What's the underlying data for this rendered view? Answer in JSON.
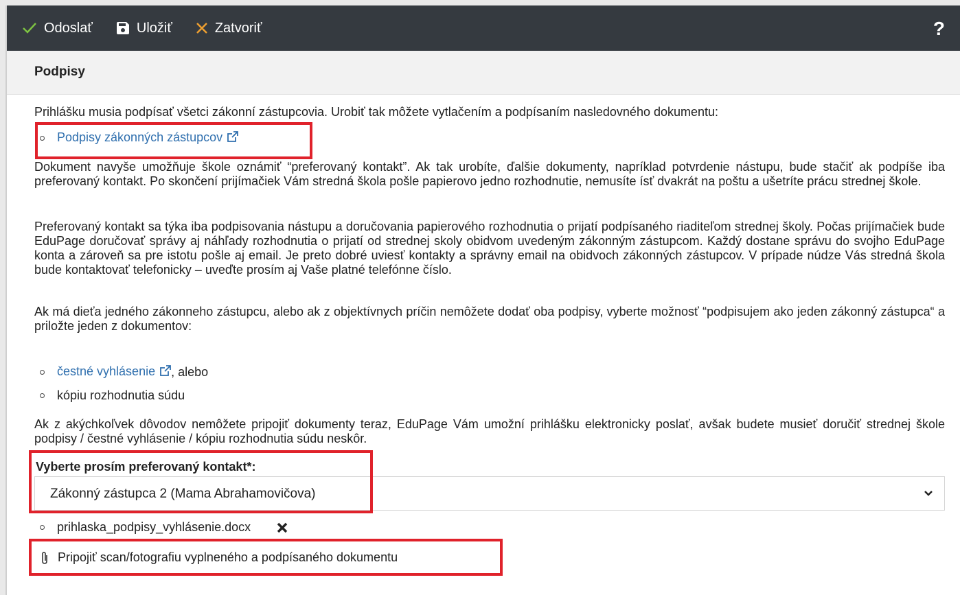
{
  "toolbar": {
    "send_label": "Odoslať",
    "save_label": "Uložiť",
    "close_label": "Zatvoriť",
    "help_label": "?"
  },
  "section": {
    "title": "Podpisy"
  },
  "content": {
    "intro": "Prihlášku musia podpísať všetci zákonní zástupcovia. Urobiť tak môžete vytlačením a podpísaním nasledovného dokumentu:",
    "signatures_link": "Podpisy zákonných zástupcov",
    "para_preferred": "Dokument navyše umožňuje škole oznámiť “preferovaný kontakt”. Ak tak urobíte, ďalšie dokumenty, napríklad potvrdenie nástupu, bude stačiť ak podpíše iba preferovaný kontakt. Po skončení prijímačiek Vám stredná škola pošle papierovo jedno rozhodnutie, nemusíte ísť dvakrát na poštu a ušetríte prácu strednej škole.",
    "para_contact": "Preferovaný kontakt sa týka iba podpisovania nástupu a doručovania papierového rozhodnutia o prijatí podpísaného riaditeľom strednej školy. Počas prijímačiek bude EduPage doručovať správy aj náhľady rozhodnutia o prijatí od strednej skoly obidvom uvedeným zákonným zástupcom. Každý dostane správu do svojho EduPage konta a zároveň sa pre istotu pošle aj email. Je preto dobré uviesť kontakty a správny email na obidvoch zákonných zástupcov. V prípade núdze Vás stredná škola bude kontaktovať telefonicky – uveďte prosím aj Vaše platné telefónne číslo.",
    "para_single": "Ak má dieťa jedného zákonneho zástupcu, alebo ak z objektívnych príčin nemôžete dodať oba podpisy, vyberte možnosť “podpisujem ako jeden zákonný zástupca“ a priložte jeden z dokumentov:",
    "honest_link": "čestné vyhlásenie",
    "honest_suffix": ", alebo",
    "court_copy": "kópiu rozhodnutia súdu",
    "para_later": "Ak z akýchkoľvek dôvodov nemôžete pripojiť dokumenty teraz, EduPage Vám umožní prihlášku elektronicky poslať, avšak budete musieť doručiť strednej škole podpisy / čestné vyhlásenie / kópiu rozhodnutia súdu neskôr.",
    "select_label": "Vyberte prosím preferovaný kontakt*:",
    "select_value": "Zákonný zástupca 2 (Mama Abrahamovičova)",
    "attached_file": "prihlaska_podpisy_vyhlásenie.docx",
    "attach_label": "Pripojiť scan/fotografiu vyplneného a podpísaného dokumentu"
  },
  "colors": {
    "toolbar_bg": "#353a40",
    "send_icon": "#7dc242",
    "close_icon": "#f0a030",
    "link": "#2f6fae",
    "highlight": "#e0222b"
  }
}
